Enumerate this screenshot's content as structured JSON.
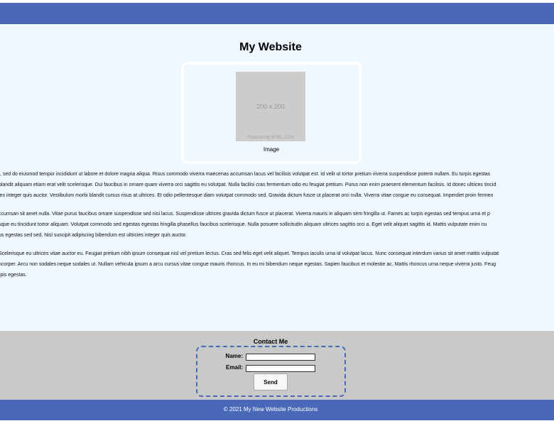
{
  "header": {
    "title": "My Website"
  },
  "figure": {
    "placeholder_size": "200 x 200",
    "placeholder_credit": "Powered by HTML.COM",
    "caption": "Image"
  },
  "article": {
    "paragraphs": [
      [
        "t, sed do eiusmod tempor incididunt ut labore et dolore magna aliqua. Risus commodo viverra maecenas accumsan lacus vel facilisis volutpat est. Id velit ut tortor pretium viverra suspendisse potenti nullam. Eu turpis egestas",
        "blandit aliquam etiam erat velit scelerisque. Dui faucibus in ornare quam viverra orci sagittis eu volutpat. Nulla facilisi cras fermentum odio eu feugiat pretium. Purus non enim praesent elementum facilisis. Id donec ultrices tincid",
        "ies integer quis auctor. Vestibulum morbi blandit cursus risus at ultrices. Et odio pellentesque diam volutpat commodo sed. Gravida dictum fusce ut placerat orci nulla. Viverra vitae congue eu consequat. Imperdiet proin fermen"
      ],
      [
        "ccumsan sit amet nulla. Vitae purus faucibus ornare suspendisse sed nisi lacus. Suspendisse ultrices gravida dictum fusce ut placerat. Viverra mauris in aliquam sem fringilla ut. Fames ac turpis egestas sed tempus urna et p",
        "sque eu tincidunt tortor aliquam. Volutpat commodo sed egestas egestas fringilla phasellus faucibus scelerisque. Nulla posuere sollicitudin aliquam ultrices sagittis orci a. Eget velit aliquet sagittis id. Mattis vulputate enim nu",
        "us egestas sed sed. Nisl suscipit adipiscing bibendum est ultricies integer quis auctor."
      ],
      [
        "Scelerisque eu ultrices vitae auctor eu. Feugiat pretium nibh ipsum consequat nisl vel pretium lectus. Cras sed felis eget velit aliquet. Tempus iaculis urna id volutpat lacus. Nunc consequat interdum varius sit amet mattis vulputat",
        "ncorper. Arcu non sodales neque sodales ut. Nullam vehicula ipsum a arcu cursus vitae congue mauris rhoncus. In eu mi bibendum neque egestas. Sapien faucibus et molestie ac. Mattis rhoncus urna neque viverra justo. Feug",
        "rpis egestas."
      ]
    ]
  },
  "contact": {
    "title": "Contact Me",
    "name_label": "Name:",
    "name_value": "",
    "email_label": "Email:",
    "email_value": "",
    "send_label": "Send"
  },
  "footer": {
    "text": "© 2021 My New Website Productions"
  },
  "colors": {
    "brand_blue": "#4a68b8",
    "main_background": "#eff7ff",
    "contact_background": "#c9c9c9"
  }
}
